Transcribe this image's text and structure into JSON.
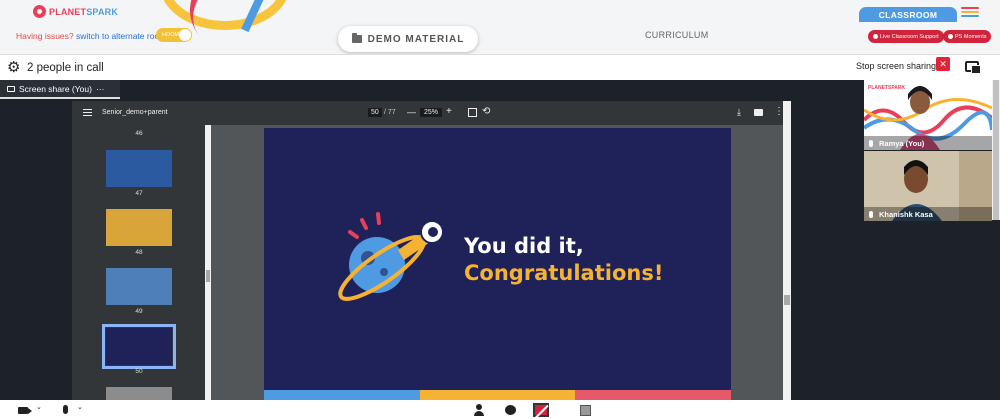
{
  "header": {
    "logo_text_a": "PLANET",
    "logo_text_b": "SPARK",
    "issues_text": "Having issues?",
    "issues_link": "switch to alternate room",
    "toggle_label": "HOOM",
    "demo_material": "DEMO MATERIAL",
    "curriculum": "CURRICULUM",
    "classroom": "CLASSROOM",
    "live_support": "Live Classroom Support",
    "ps_moments": "PS Moments"
  },
  "callbar": {
    "people_in_call": "2 people in call",
    "stop_sharing": "Stop screen sharing",
    "stop_icon": "✕"
  },
  "share_tab": {
    "label": "Screen share (You)",
    "more": "···"
  },
  "viewer": {
    "file_name": "Senior_demo+parent",
    "current_page": "50",
    "total_pages": "/ 77",
    "zoom": "25%",
    "minus": "—",
    "plus": "+",
    "rotate": "⟲",
    "download": "⤓",
    "more": "⋮",
    "thumbnails": [
      {
        "num": "46",
        "color": "#1f3b6e"
      },
      {
        "num": "47",
        "color": "#2c5aa0"
      },
      {
        "num": "48",
        "color": "#d9a53a"
      },
      {
        "num": "49",
        "color": "#4e7fb8"
      },
      {
        "num": "50",
        "color": "#1f2258"
      },
      {
        "num": "",
        "color": "#8c8c8c"
      }
    ]
  },
  "slide": {
    "line1": "You did it,",
    "line2": "Congratulations!",
    "bottom_colors": [
      "#4f9be3",
      "#f5b233",
      "#e45a6a"
    ]
  },
  "videos": [
    {
      "name": "Ramya (You)"
    },
    {
      "name": "Khanishk Kasa"
    }
  ],
  "colors": {
    "accent_red": "#d0243d",
    "accent_blue": "#4f9be3",
    "accent_yellow": "#f5b233",
    "slide_bg": "#1f2258"
  }
}
